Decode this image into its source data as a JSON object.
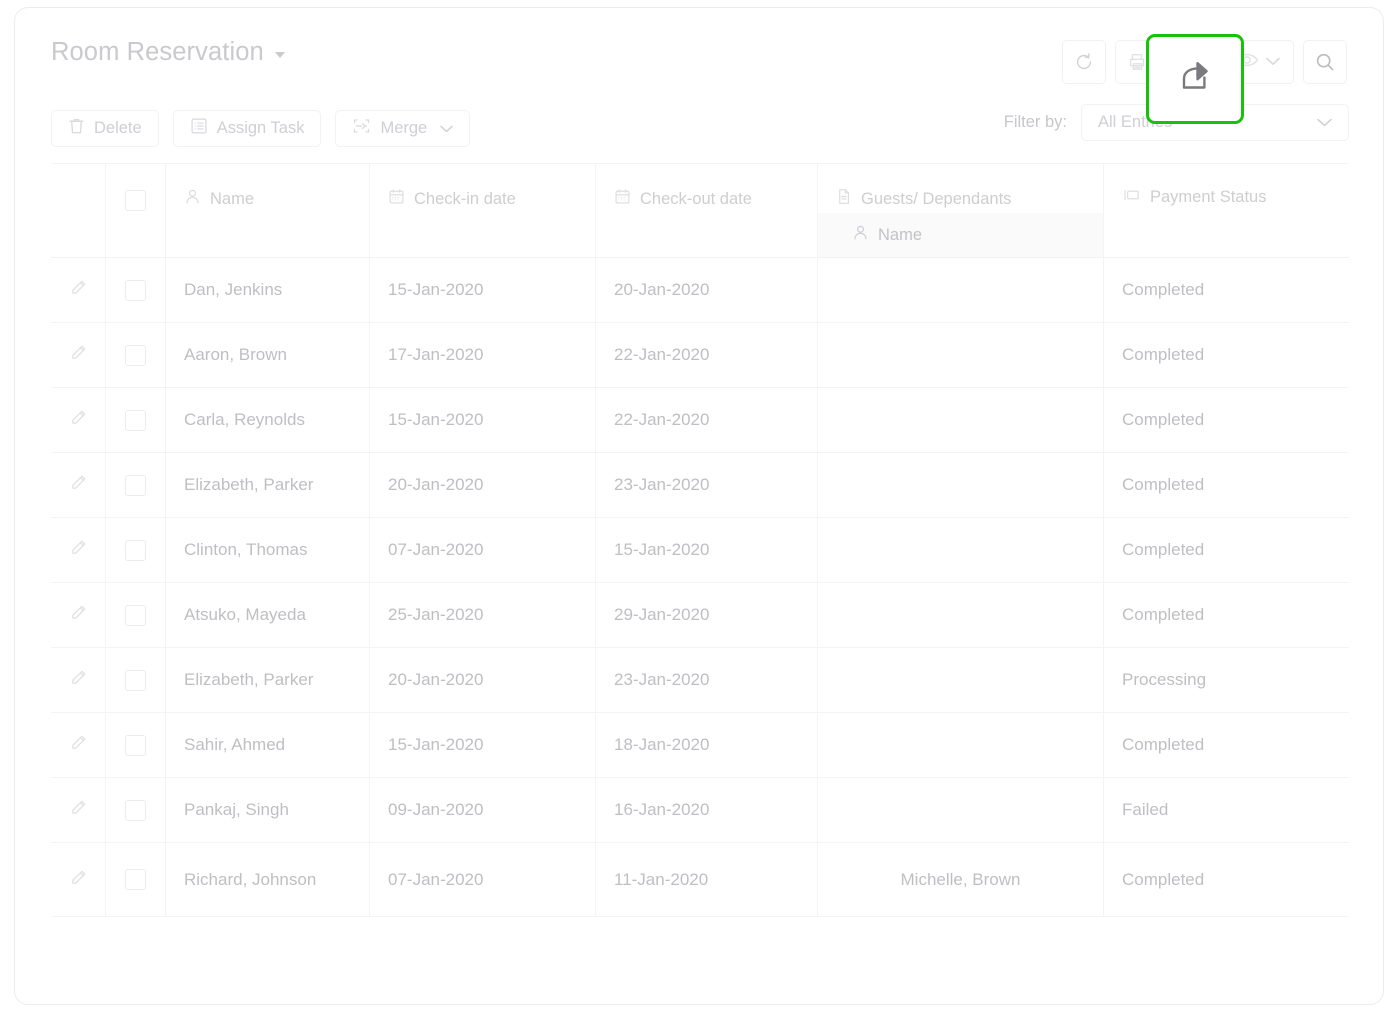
{
  "header": {
    "title": "Room Reservation",
    "title_caret_icon": "caret-down-icon",
    "actions": [
      {
        "name": "refresh-icon",
        "label": "Refresh"
      },
      {
        "name": "print-icon",
        "label": "Print"
      },
      {
        "name": "share-icon",
        "label": "Share"
      },
      {
        "name": "eye-icon",
        "label": "View"
      },
      {
        "name": "search-icon",
        "label": "Search"
      }
    ]
  },
  "toolbar": {
    "delete_label": "Delete",
    "delete_icon": "trash-icon",
    "assign_task_label": "Assign Task",
    "assign_task_icon": "list-icon",
    "merge_label": "Merge",
    "merge_icon": "merge-icon",
    "merge_caret_icon": "chevron-down-icon",
    "filter_label": "Filter by:",
    "filter_value": "All Entries",
    "filter_caret_icon": "chevron-down-icon"
  },
  "table": {
    "columns": [
      {
        "key": "edit",
        "label": "",
        "icon": ""
      },
      {
        "key": "select",
        "label": "",
        "icon": "checkbox-icon"
      },
      {
        "key": "name",
        "label": "Name",
        "icon": "user-icon"
      },
      {
        "key": "checkin",
        "label": "Check-in date",
        "icon": "calendar-icon"
      },
      {
        "key": "checkout",
        "label": "Check-out date",
        "icon": "calendar-icon"
      },
      {
        "key": "guests",
        "label": "Guests/ Dependants",
        "icon": "document-icon"
      },
      {
        "key": "payment",
        "label": "Payment Status",
        "icon": "card-icon"
      }
    ],
    "guests_subheader": {
      "label": "Name",
      "icon": "user-icon"
    },
    "row_edit_icon": "pencil-icon",
    "rows": [
      {
        "name": "Dan, Jenkins",
        "checkin": "15-Jan-2020",
        "checkout": "20-Jan-2020",
        "guest": "",
        "payment": "Completed"
      },
      {
        "name": "Aaron, Brown",
        "checkin": "17-Jan-2020",
        "checkout": "22-Jan-2020",
        "guest": "",
        "payment": "Completed"
      },
      {
        "name": "Carla, Reynolds",
        "checkin": "15-Jan-2020",
        "checkout": "22-Jan-2020",
        "guest": "",
        "payment": "Completed"
      },
      {
        "name": "Elizabeth, Parker",
        "checkin": "20-Jan-2020",
        "checkout": "23-Jan-2020",
        "guest": "",
        "payment": "Completed"
      },
      {
        "name": "Clinton, Thomas",
        "checkin": "07-Jan-2020",
        "checkout": "15-Jan-2020",
        "guest": "",
        "payment": "Completed"
      },
      {
        "name": "Atsuko, Mayeda",
        "checkin": "25-Jan-2020",
        "checkout": "29-Jan-2020",
        "guest": "",
        "payment": "Completed"
      },
      {
        "name": "Elizabeth, Parker",
        "checkin": "20-Jan-2020",
        "checkout": "23-Jan-2020",
        "guest": "",
        "payment": "Processing"
      },
      {
        "name": "Sahir, Ahmed",
        "checkin": "15-Jan-2020",
        "checkout": "18-Jan-2020",
        "guest": "",
        "payment": "Completed"
      },
      {
        "name": "Pankaj, Singh",
        "checkin": "09-Jan-2020",
        "checkout": "16-Jan-2020",
        "guest": "",
        "payment": "Failed"
      },
      {
        "name": "Richard, Johnson",
        "checkin": "07-Jan-2020",
        "checkout": "11-Jan-2020",
        "guest": "Michelle, Brown",
        "payment": "Completed"
      }
    ]
  },
  "highlight": {
    "target_icon": "share-icon",
    "color": "#16c20b"
  }
}
